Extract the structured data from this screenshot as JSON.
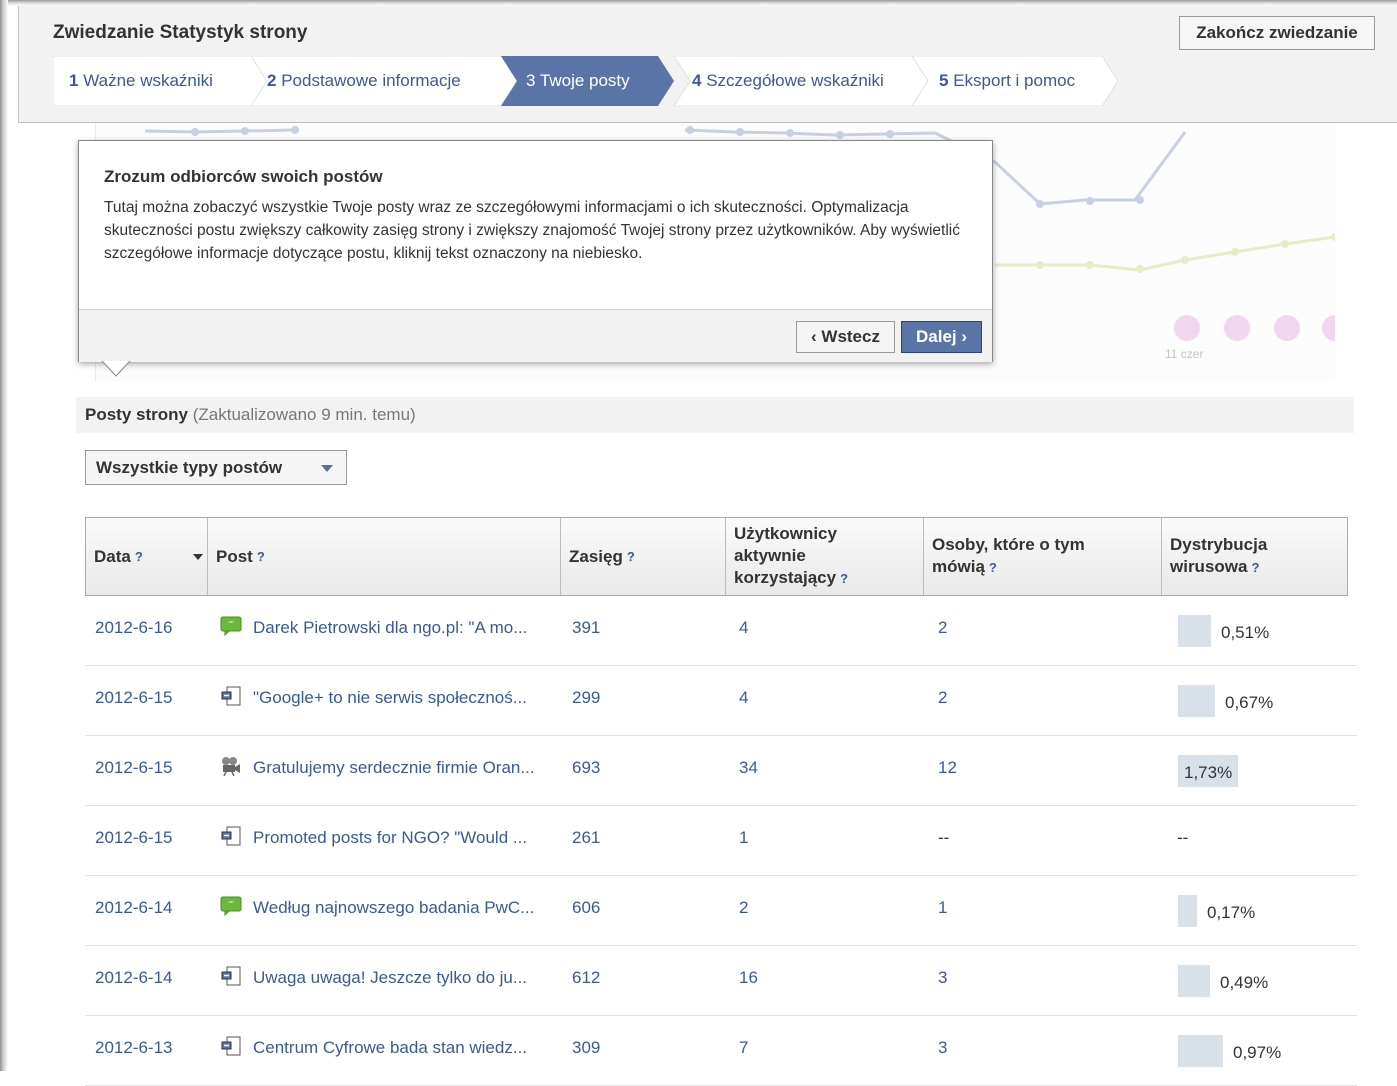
{
  "tour": {
    "title": "Zwiedzanie Statystyk strony",
    "end_button": "Zakończ zwiedzanie",
    "steps": [
      {
        "num": "1",
        "label": "Ważne wskaźniki"
      },
      {
        "num": "2",
        "label": "Podstawowe informacje"
      },
      {
        "num": "3",
        "label": "Twoje posty"
      },
      {
        "num": "4",
        "label": "Szczegółowe wskaźniki"
      },
      {
        "num": "5",
        "label": "Eksport i pomoc"
      }
    ],
    "active_step": 3
  },
  "popover": {
    "title": "Zrozum odbiorców swoich postów",
    "body": "Tutaj można zobaczyć wszystkie Twoje posty wraz ze szczegółowymi informacjami o ich skuteczności. Optymalizacja skuteczności postu zwiększy całkowity zasięg strony i zwiększy znajomość Twojej strony przez użytkowników. Aby wyświetlić szczegółowe informacje dotyczące postu, kliknij tekst oznaczony na niebiesko.",
    "back_button": "‹ Wstecz",
    "next_button": "Dalej ›"
  },
  "chart": {
    "x_tick": "11 czer"
  },
  "posts": {
    "title": "Posty strony",
    "updated": "(Zaktualizowano 9 min. temu)",
    "filter": "Wszystkie typy postów",
    "columns": {
      "date": "Data",
      "post": "Post",
      "reach": "Zasięg",
      "engaged": "Użytkownicy aktywnie korzystający",
      "talking": "Osoby, które o tym mówią",
      "viral": "Dystrybucja wirusowa"
    },
    "help": "?",
    "rows": [
      {
        "date": "2012-6-16",
        "icon": "status-icon",
        "post": "Darek Pietrowski dla ngo.pl: \"A mo...",
        "reach": "391",
        "engaged": "4",
        "talking": "2",
        "viral": "0,51%",
        "viral_value": 0.51
      },
      {
        "date": "2012-6-15",
        "icon": "link-icon",
        "post": "\"Google+ to nie serwis społecznoś...",
        "reach": "299",
        "engaged": "4",
        "talking": "2",
        "viral": "0,67%",
        "viral_value": 0.67
      },
      {
        "date": "2012-6-15",
        "icon": "video-icon",
        "post": "Gratulujemy serdecznie firmie Oran...",
        "reach": "693",
        "engaged": "34",
        "talking": "12",
        "viral": "1,73%",
        "viral_value": 1.73
      },
      {
        "date": "2012-6-15",
        "icon": "link-icon",
        "post": "Promoted posts for NGO? \"Would ...",
        "reach": "261",
        "engaged": "1",
        "talking": "--",
        "viral": "--",
        "viral_value": 0
      },
      {
        "date": "2012-6-14",
        "icon": "status-icon",
        "post": "Według najnowszego badania PwC...",
        "reach": "606",
        "engaged": "2",
        "talking": "1",
        "viral": "0,17%",
        "viral_value": 0.17
      },
      {
        "date": "2012-6-14",
        "icon": "link-icon",
        "post": "Uwaga uwaga! Jeszcze tylko do ju...",
        "reach": "612",
        "engaged": "16",
        "talking": "3",
        "viral": "0,49%",
        "viral_value": 0.49
      },
      {
        "date": "2012-6-13",
        "icon": "link-icon",
        "post": "Centrum Cyfrowe bada stan wiedz...",
        "reach": "309",
        "engaged": "7",
        "talking": "3",
        "viral": "0,97%",
        "viral_value": 0.97
      }
    ]
  },
  "colors": {
    "link": "#3b5998",
    "active_step": "#5b74a8",
    "viral_bar": "#d8e0ea"
  }
}
